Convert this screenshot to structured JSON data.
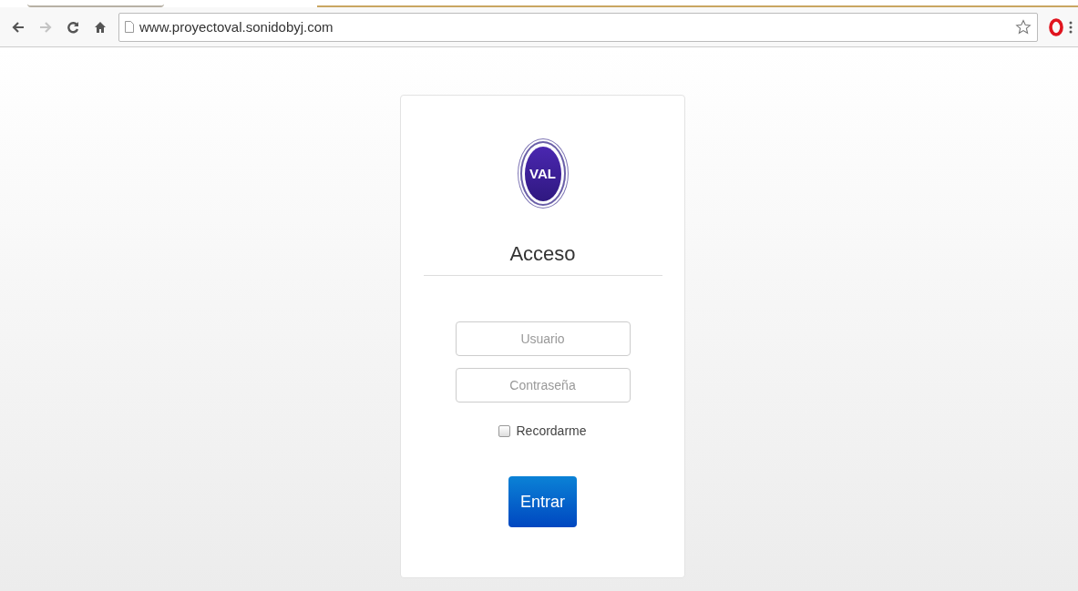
{
  "browser": {
    "nav": [
      {
        "kind": "back",
        "disabled": false
      },
      {
        "kind": "forward",
        "disabled": true
      },
      {
        "kind": "reload",
        "disabled": false
      },
      {
        "kind": "home",
        "disabled": false
      }
    ],
    "url": "www.proyectoval.sonidobyj.com",
    "bookmarked": false
  },
  "login": {
    "logo": "VAL",
    "title": "Acceso",
    "fields": [
      {
        "placeholder": "Usuario"
      },
      {
        "placeholder": "Contraseña"
      }
    ],
    "remember": {
      "label": "Recordarme",
      "checked": false
    },
    "submit": "Entrar"
  }
}
